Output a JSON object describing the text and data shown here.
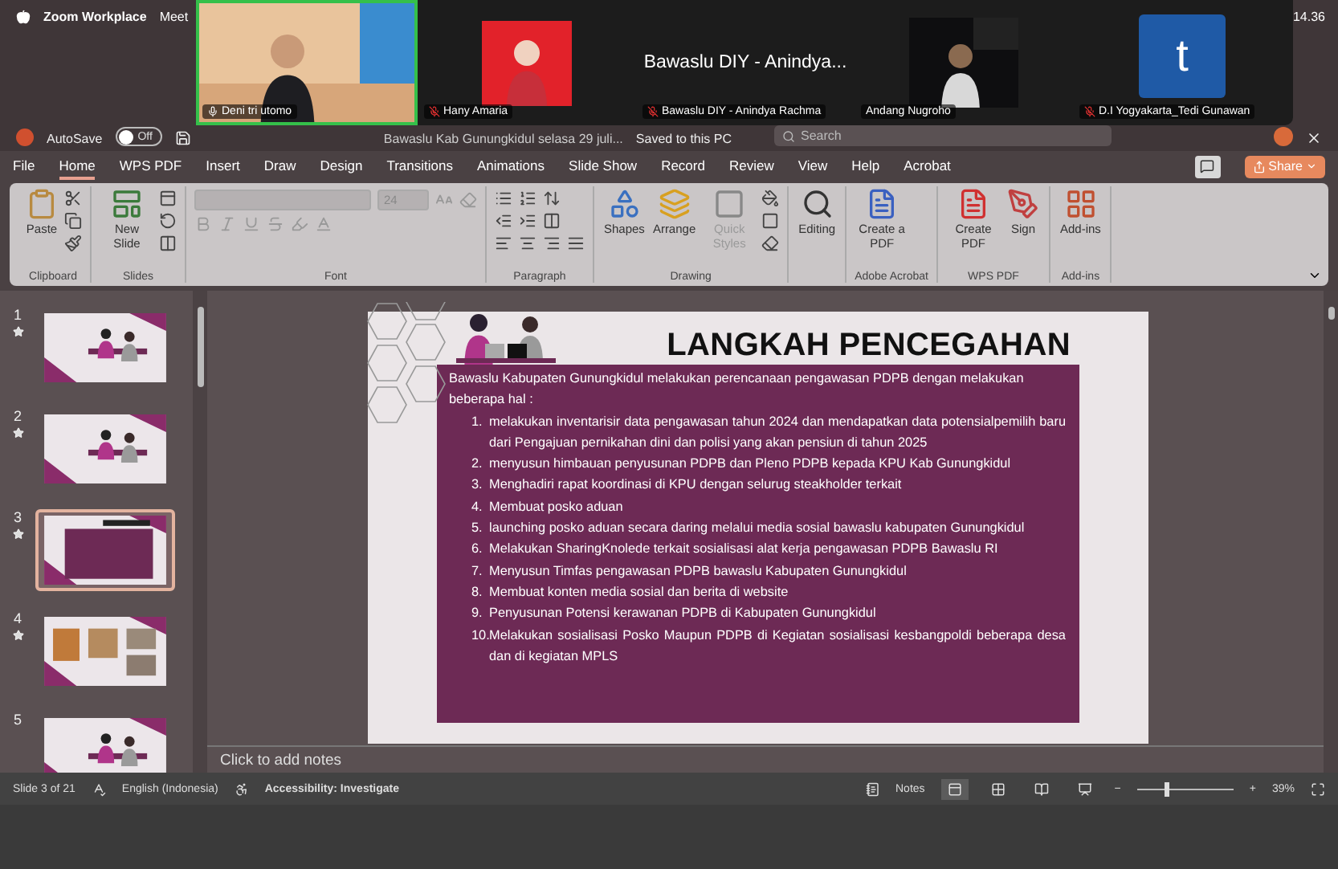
{
  "menubar": {
    "app": "Zoom Workplace",
    "menu": "Meet",
    "clock": "14.36"
  },
  "participants": [
    {
      "name": "Deni tri utomo",
      "kind": "video",
      "speaking": true,
      "mic": true,
      "muted": false
    },
    {
      "name": "Hany Amaria",
      "speaking": false,
      "mic": true,
      "muted": true
    },
    {
      "name": "Bawaslu DIY - Anindya Rachma",
      "kind": "text",
      "display": "Bawaslu DIY - Anindya...",
      "speaking": false,
      "mic": true,
      "muted": true
    },
    {
      "name": "Andang Nugroho",
      "kind": "video",
      "speaking": false,
      "mic": false
    },
    {
      "name": "D.I Yogyakarta_Tedi Gunawan",
      "kind": "letter",
      "display": "t",
      "speaking": false,
      "mic": true,
      "muted": true
    }
  ],
  "titlebar": {
    "autosave": "AutoSave",
    "autosave_on": false,
    "autosave_state": "Off",
    "filename": "Bawaslu Kab Gunungkidul selasa 29 juli...",
    "save_status": "Saved to this PC",
    "search_placeholder": "Search"
  },
  "tabs": [
    {
      "label": "File",
      "selected": false
    },
    {
      "label": "Home",
      "selected": true
    },
    {
      "label": "WPS PDF",
      "selected": false
    },
    {
      "label": "Insert",
      "selected": false
    },
    {
      "label": "Draw",
      "selected": false
    },
    {
      "label": "Design",
      "selected": false
    },
    {
      "label": "Transitions",
      "selected": false
    },
    {
      "label": "Animations",
      "selected": false
    },
    {
      "label": "Slide Show",
      "selected": false
    },
    {
      "label": "Record",
      "selected": false
    },
    {
      "label": "Review",
      "selected": false
    },
    {
      "label": "View",
      "selected": false
    },
    {
      "label": "Help",
      "selected": false
    },
    {
      "label": "Acrobat",
      "selected": false
    }
  ],
  "share": "Share",
  "ribbon": [
    {
      "label": "Clipboard",
      "buttons": [
        {
          "label": "Paste",
          "disabled": false
        }
      ]
    },
    {
      "label": "Slides",
      "buttons": [
        {
          "label": "New Slide",
          "disabled": false
        }
      ]
    },
    {
      "label": "Font",
      "font_size": "24",
      "disabled": true
    },
    {
      "label": "Paragraph"
    },
    {
      "label": "Drawing",
      "buttons": [
        {
          "label": "Shapes",
          "disabled": false
        },
        {
          "label": "Arrange",
          "disabled": false
        },
        {
          "label": "Quick Styles",
          "disabled": true
        }
      ]
    },
    {
      "buttons": [
        {
          "label": "Editing",
          "disabled": false
        }
      ]
    },
    {
      "label": "Adobe Acrobat",
      "buttons": [
        {
          "label": "Create a PDF",
          "disabled": false
        }
      ]
    },
    {
      "label": "WPS PDF",
      "buttons": [
        {
          "label": "Create PDF",
          "disabled": false
        },
        {
          "label": "Sign",
          "disabled": false
        }
      ]
    },
    {
      "label": "Add-ins",
      "buttons": [
        {
          "label": "Add-ins",
          "disabled": false
        }
      ]
    }
  ],
  "slides": [
    {
      "number": "1",
      "starred": true,
      "selected": false
    },
    {
      "number": "2",
      "starred": true,
      "selected": false
    },
    {
      "number": "3",
      "starred": true,
      "selected": true
    },
    {
      "number": "4",
      "starred": true,
      "selected": false
    },
    {
      "number": "5",
      "starred": false,
      "selected": false
    }
  ],
  "slide": {
    "title": "LANGKAH PENCEGAHAN",
    "intro": "Bawaslu Kabupaten Gunungkidul melakukan perencanaan pengawasan PDPB dengan melakukan beberapa hal :",
    "items": [
      {
        "number": "1.",
        "text": "melakukan inventarisir data pengawasan tahun 2024 dan mendapatkan data potensialpemilih baru dari Pengajuan pernikahan dini dan polisi yang akan pensiun di tahun 2025"
      },
      {
        "number": "2.",
        "text": "menyusun himbauan penyusunan PDPB dan Pleno PDPB kepada KPU Kab Gunungkidul"
      },
      {
        "number": "3.",
        "text": "Menghadiri rapat koordinasi di KPU dengan selurug steakholder terkait"
      },
      {
        "number": "4.",
        "text": "Membuat posko aduan"
      },
      {
        "number": "5.",
        "text": "launching posko aduan secara daring melalui media sosial bawaslu kabupaten Gunungkidul"
      },
      {
        "number": "6.",
        "text": "Melakukan SharingKnolede terkait sosialisasi alat kerja pengawasan PDPB Bawaslu RI"
      },
      {
        "number": "7.",
        "text": "Menyusun Timfas pengawasan PDPB bawaslu Kabupaten Gunungkidul"
      },
      {
        "number": "8.",
        "text": "Membuat konten media sosial dan berita di website"
      },
      {
        "number": "9.",
        "text": "Penyusunan Potensi kerawanan PDPB di Kabupaten Gunungkidul"
      },
      {
        "number": "10.",
        "text": "Melakukan sosialisasi Posko Maupun PDPB di Kegiatan sosialisasi kesbangpoldi beberapa desa dan di kegiatan MPLS"
      }
    ]
  },
  "notes_placeholder": "Click to add notes",
  "status": {
    "slide_counter": "Slide 3 of 21",
    "language": "English (Indonesia)",
    "accessibility": "Accessibility: Investigate",
    "notes": "Notes",
    "views": [
      {
        "selected": true
      },
      {
        "selected": false
      },
      {
        "selected": false
      },
      {
        "selected": false
      }
    ],
    "zoom": {
      "minus": "−",
      "plus": "+",
      "level": 0.28,
      "value": "39%"
    }
  }
}
